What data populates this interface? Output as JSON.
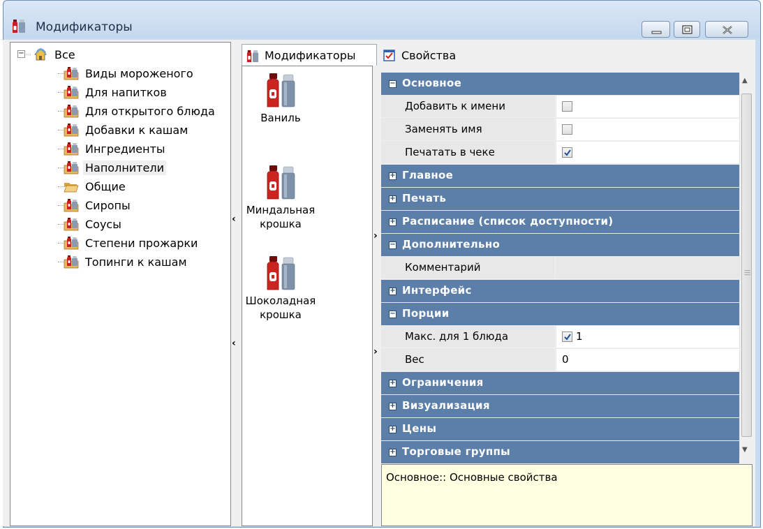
{
  "window": {
    "title": "Модификаторы",
    "controls": {
      "minimize": "minimize",
      "maximize": "maximize",
      "close": "close"
    }
  },
  "tree": {
    "root": {
      "label": "Все",
      "expanded": true
    },
    "items": [
      {
        "label": "Виды мороженого",
        "icon": "folder-bottle-icon"
      },
      {
        "label": "Для напитков",
        "icon": "folder-bottle-icon"
      },
      {
        "label": "Для открытого блюда",
        "icon": "folder-bottle-icon"
      },
      {
        "label": "Добавки к кашам",
        "icon": "folder-bottle-icon"
      },
      {
        "label": "Ингредиенты",
        "icon": "folder-bottle-icon"
      },
      {
        "label": "Наполнители",
        "icon": "folder-bottle-icon",
        "selected": true
      },
      {
        "label": "Общие",
        "icon": "open-folder-icon"
      },
      {
        "label": "Сиропы",
        "icon": "folder-bottle-icon"
      },
      {
        "label": "Соусы",
        "icon": "folder-bottle-icon"
      },
      {
        "label": "Степени прожарки",
        "icon": "folder-bottle-icon"
      },
      {
        "label": "Топинги к кашам",
        "icon": "folder-bottle-icon"
      }
    ]
  },
  "tabs": [
    {
      "label": "Модификаторы",
      "icon": "modifiers-icon",
      "active": true
    },
    {
      "label": "Свойства",
      "icon": "properties-icon",
      "active": false
    }
  ],
  "modifiers": [
    {
      "label": "Ваниль",
      "icon": "ketchup-salt-icon"
    },
    {
      "label": "Миндальная крошка",
      "icon": "ketchup-salt-icon"
    },
    {
      "label": "Шоколадная крошка",
      "icon": "ketchup-salt-icon"
    }
  ],
  "property_grid": {
    "rows": [
      {
        "type": "category",
        "label": "Основное",
        "expanded": true
      },
      {
        "type": "property",
        "label": "Добавить к имени",
        "checkbox": true,
        "checked": false
      },
      {
        "type": "property",
        "label": "Заменять имя",
        "checkbox": true,
        "checked": false
      },
      {
        "type": "property",
        "label": "Печатать в чеке",
        "checkbox": true,
        "checked": true
      },
      {
        "type": "category",
        "label": "Главное",
        "expanded": false
      },
      {
        "type": "category",
        "label": "Печать",
        "expanded": false
      },
      {
        "type": "category",
        "label": "Расписание (список доступности)",
        "expanded": false
      },
      {
        "type": "category",
        "label": "Дополнительно",
        "expanded": true
      },
      {
        "type": "property",
        "label": "Комментарий",
        "empty": true
      },
      {
        "type": "category",
        "label": "Интерфейс",
        "expanded": false
      },
      {
        "type": "category",
        "label": "Порции",
        "expanded": true
      },
      {
        "type": "property",
        "label": "Макс. для 1 блюда",
        "checkbox": true,
        "checked": true,
        "value": "1"
      },
      {
        "type": "property",
        "label": "Вес",
        "value": "0"
      },
      {
        "type": "category",
        "label": "Ограничения",
        "expanded": false
      },
      {
        "type": "category",
        "label": "Визуализация",
        "expanded": false
      },
      {
        "type": "category",
        "label": "Цены",
        "expanded": false
      },
      {
        "type": "category",
        "label": "Торговые группы",
        "expanded": false
      }
    ]
  },
  "help": {
    "text": "Основное:: Основные свойства"
  },
  "colors": {
    "category_bg": "#5b7fa8",
    "help_bg": "#ffffe1",
    "title_bg": "#c9dcef"
  }
}
